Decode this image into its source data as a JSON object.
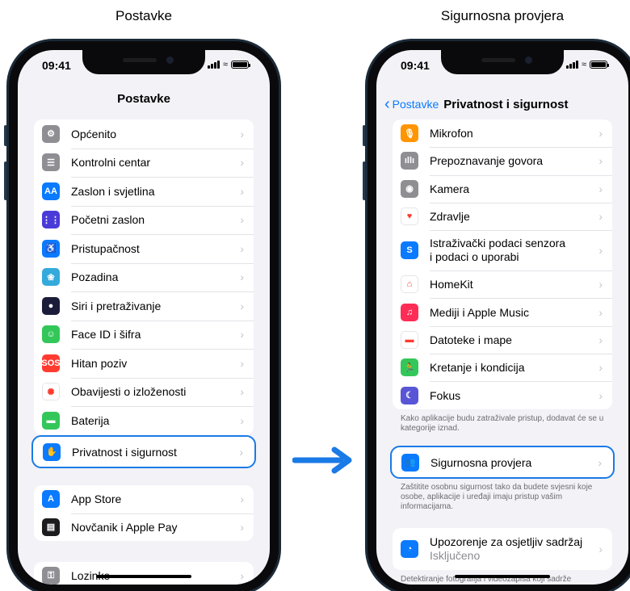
{
  "captions": {
    "left": "Postavke",
    "right": "Sigurnosna provjera"
  },
  "status": {
    "time": "09:41"
  },
  "left": {
    "nav_title": "Postavke",
    "group1": [
      {
        "label": "Općenito",
        "icon": "gear-icon",
        "color": "#8e8e93",
        "glyph": "⚙"
      },
      {
        "label": "Kontrolni centar",
        "icon": "toggles-icon",
        "color": "#8e8e93",
        "glyph": "☰"
      },
      {
        "label": "Zaslon i svjetlina",
        "icon": "display-aa-icon",
        "color": "#0a7aff",
        "glyph": "AA"
      },
      {
        "label": "Početni zaslon",
        "icon": "home-grid-icon",
        "color": "#4a3bd8",
        "glyph": "⋮⋮"
      },
      {
        "label": "Pristupačnost",
        "icon": "accessibility-icon",
        "color": "#0a7aff",
        "glyph": "♿"
      },
      {
        "label": "Pozadina",
        "icon": "wallpaper-flower-icon",
        "color": "#34aadc",
        "glyph": "❀"
      },
      {
        "label": "Siri i pretraživanje",
        "icon": "siri-icon",
        "color": "#1b1b3a",
        "glyph": "●"
      },
      {
        "label": "Face ID i šifra",
        "icon": "face-id-icon",
        "color": "#33c759",
        "glyph": "☺"
      },
      {
        "label": "Hitan poziv",
        "icon": "sos-icon",
        "color": "#ff3b30",
        "glyph": "SOS"
      },
      {
        "label": "Obavijesti o izloženosti",
        "icon": "exposure-icon",
        "color": "#ffffff",
        "glyph": "✺"
      },
      {
        "label": "Baterija",
        "icon": "battery-icon",
        "color": "#33c759",
        "glyph": "▬"
      }
    ],
    "privacy": {
      "label": "Privatnost i sigurnost",
      "icon": "hand-icon",
      "color": "#0a7aff",
      "glyph": "✋"
    },
    "group2": [
      {
        "label": "App Store",
        "icon": "app-store-icon",
        "color": "#0a7aff",
        "glyph": "A"
      },
      {
        "label": "Novčanik i Apple Pay",
        "icon": "wallet-icon",
        "color": "#1c1c1e",
        "glyph": "▤"
      }
    ],
    "group3": [
      {
        "label": "Lozinke",
        "icon": "key-icon",
        "color": "#8e8e93",
        "glyph": "⚿"
      }
    ]
  },
  "right": {
    "back_label": "Postavke",
    "nav_title": "Privatnost i sigurnost",
    "group1": [
      {
        "label": "Mikrofon",
        "icon": "microphone-icon",
        "color": "#ff9500",
        "glyph": "🎙"
      },
      {
        "label": "Prepoznavanje govora",
        "icon": "waveform-icon",
        "color": "#8e8e93",
        "glyph": "ıllı"
      },
      {
        "label": "Kamera",
        "icon": "camera-icon",
        "color": "#8e8e93",
        "glyph": "◉"
      },
      {
        "label": "Zdravlje",
        "icon": "heart-icon",
        "color": "#ffffff",
        "glyph": "♥"
      }
    ],
    "sensor": {
      "line1": "Istraživački podaci senzora",
      "line2": "i podaci o uporabi",
      "icon": "research-icon",
      "color": "#0a7aff",
      "glyph": "S"
    },
    "group1b": [
      {
        "label": "HomeKit",
        "icon": "homekit-icon",
        "color": "#ffffff",
        "glyph": "⌂"
      },
      {
        "label": "Mediji i Apple Music",
        "icon": "music-note-icon",
        "color": "#ff2d55",
        "glyph": "♫"
      },
      {
        "label": "Datoteke i mape",
        "icon": "folder-icon",
        "color": "#ffffff",
        "glyph": "▬"
      },
      {
        "label": "Kretanje i kondicija",
        "icon": "fitness-runner-icon",
        "color": "#33c759",
        "glyph": "🏃"
      },
      {
        "label": "Fokus",
        "icon": "moon-icon",
        "color": "#5856d6",
        "glyph": "☾"
      }
    ],
    "note1": "Kako aplikacije budu zatraživale pristup, dodavat će se u kategorije iznad.",
    "safety": {
      "label": "Sigurnosna provjera",
      "icon": "safety-check-icon",
      "color": "#0a7aff",
      "glyph": "👥"
    },
    "note2": "Zaštitite osobnu sigurnost tako da budete svjesni koje osobe, aplikacije i uređaji imaju pristup vašim informacijama.",
    "sensitive": {
      "label": "Upozorenje za osjetljiv sadržaj",
      "value": "Isključeno",
      "icon": "sensitive-eye-icon",
      "color": "#0a7aff",
      "glyph": "◔"
    },
    "note3": "Detektiranje fotografija i videozapisa koji sadrže"
  }
}
